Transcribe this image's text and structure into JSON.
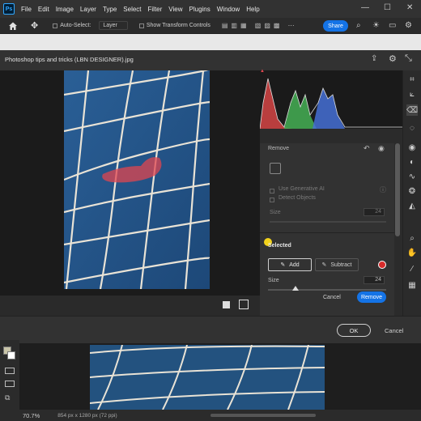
{
  "app": {
    "logo": "Ps"
  },
  "menubar": {
    "items": [
      "File",
      "Edit",
      "Image",
      "Layer",
      "Type",
      "Select",
      "Filter",
      "View",
      "Plugins",
      "Window",
      "Help"
    ]
  },
  "window_controls": {
    "minimize": "—",
    "maximize": "☐",
    "close": "✕"
  },
  "options_bar": {
    "auto_select_label": "Auto-Select:",
    "layer_dropdown": "Layer",
    "show_transform_label": "Show Transform Controls",
    "share_label": "Share"
  },
  "dialog": {
    "title": "Photoshop tips and tricks (LBN DESIGNER).jpg",
    "ok_label": "OK",
    "cancel_label": "Cancel"
  },
  "remove_panel": {
    "title": "Remove",
    "use_generative_ai": "Use Generative AI",
    "detect_objects": "Detect Objects",
    "size_label_top": "Size",
    "size_value_top": "24",
    "selected_heading": "Selected",
    "add_label": "Add",
    "subtract_label": "Subtract",
    "size_label": "Size",
    "size_value": "24",
    "cancel_label": "Cancel",
    "remove_label": "Remove"
  },
  "statusbar": {
    "zoom": "70.7%",
    "doc_info": "854 px x 1280 px (72 ppi)"
  },
  "colors": {
    "accent": "#1473e6",
    "mask": "#e0464f",
    "net_bg": "#23527f"
  }
}
